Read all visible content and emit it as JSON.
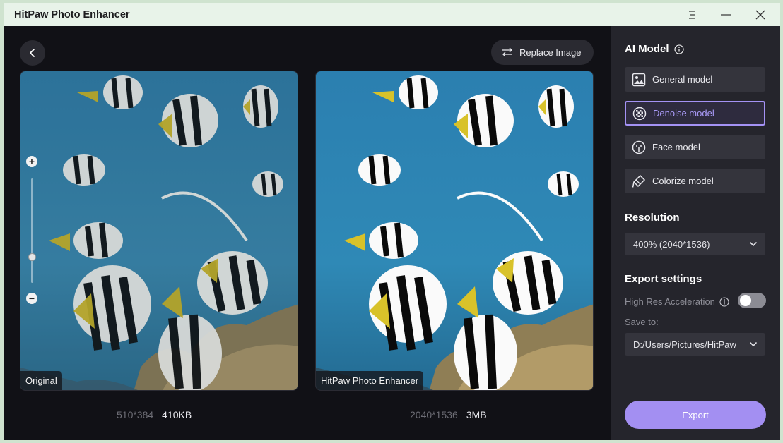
{
  "window": {
    "title": "HitPaw Photo Enhancer"
  },
  "toolbar": {
    "replace_label": "Replace Image"
  },
  "original": {
    "label": "Original",
    "dimensions": "510*384",
    "file_size": "410KB"
  },
  "enhanced": {
    "label": "HitPaw Photo Enhancer",
    "dimensions": "2040*1536",
    "file_size": "3MB"
  },
  "zoom": {
    "level_fraction": 0.75
  },
  "sidebar": {
    "ai_model_title": "AI Model",
    "models": [
      {
        "label": "General model",
        "icon": "image-icon",
        "selected": false
      },
      {
        "label": "Denoise model",
        "icon": "denoise-icon",
        "selected": true
      },
      {
        "label": "Face model",
        "icon": "face-icon",
        "selected": false
      },
      {
        "label": "Colorize model",
        "icon": "colorize-icon",
        "selected": false
      }
    ],
    "resolution_title": "Resolution",
    "resolution_value": "400% (2040*1536)",
    "export_settings_title": "Export settings",
    "high_res_label": "High Res Acceleration",
    "high_res_enabled": false,
    "save_to_label": "Save to:",
    "save_to_path": "D:/Users/Pictures/HitPaw",
    "export_label": "Export"
  },
  "colors": {
    "accent": "#a38ff2",
    "panel": "#25252c",
    "background": "#111116",
    "titlebar": "#e8f3e9"
  }
}
